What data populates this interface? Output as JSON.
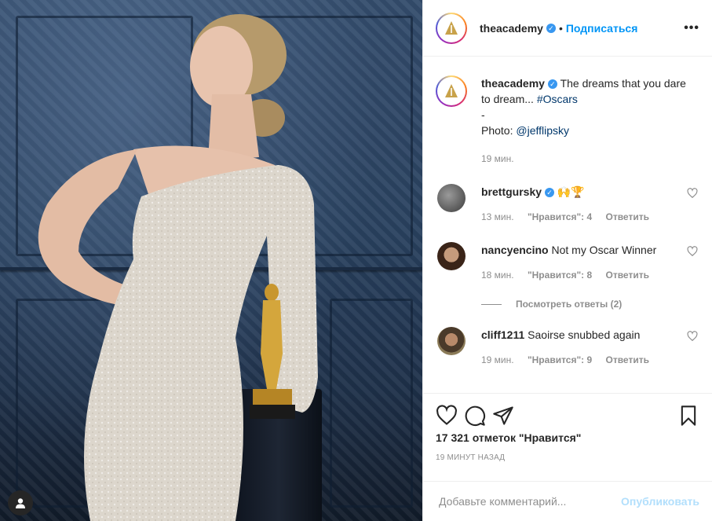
{
  "post": {
    "username": "theacademy",
    "verified_mark": "✓",
    "dot": "•",
    "follow_label": "Подписаться",
    "more_label": "•••"
  },
  "caption": {
    "username": "theacademy",
    "text": "The dreams that you dare to dream...",
    "hashtag": "#Oscars",
    "dash": "-",
    "photo_prefix": "Photo:",
    "photo_credit": "@jefflipsky",
    "time": "19 мин."
  },
  "comments": [
    {
      "username": "brettgursky",
      "text": "🙌🏆",
      "time": "13 мин.",
      "likes": "\"Нравится\": 4",
      "reply": "Ответить"
    },
    {
      "username": "nancyencino",
      "text": "Not my Oscar Winner",
      "time": "18 мин.",
      "likes": "\"Нравится\": 8",
      "reply": "Ответить"
    },
    {
      "username": "cliff1211",
      "text": "Saoirse snubbed again",
      "time": "19 мин.",
      "likes": "\"Нравится\": 9",
      "reply": "Ответить"
    }
  ],
  "view_replies": "Посмотреть ответы (2)",
  "likes_text": "17 321 отметок \"Нравится\"",
  "time_ago": "19 МИНУТ НАЗАД",
  "add_comment": {
    "placeholder": "Добавьте комментарий...",
    "post_label": "Опубликовать"
  },
  "colors": {
    "link": "#00376b",
    "follow": "#0095f6",
    "verified": "#3897f0",
    "post_disabled": "#b2dffc"
  },
  "icons": [
    "heart-icon",
    "comment-icon",
    "share-icon",
    "bookmark-icon",
    "verified-icon",
    "more-icon",
    "user-icon"
  ]
}
